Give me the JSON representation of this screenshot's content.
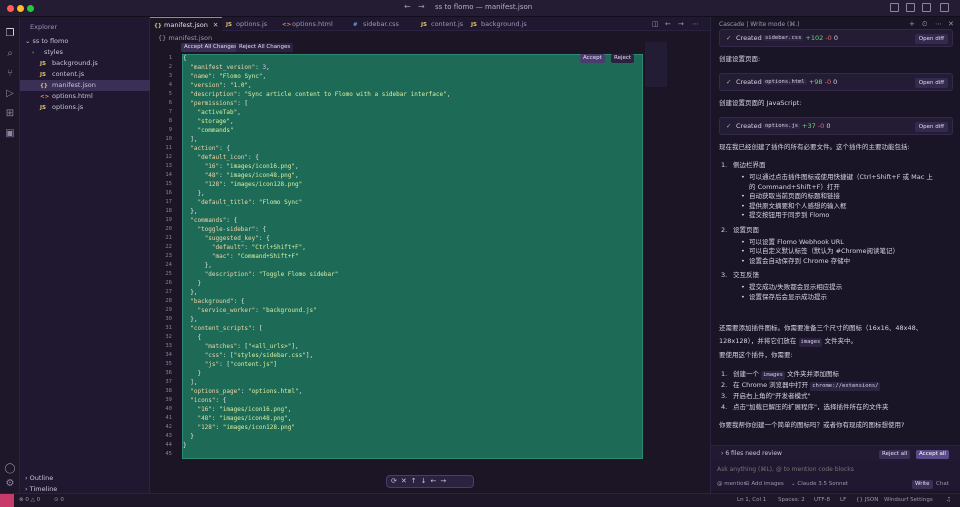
{
  "window": {
    "title": "ss to flomo — manifest.json"
  },
  "sidebar": {
    "header": "Explorer",
    "root": "ss to flomo",
    "items": [
      {
        "icon": "›",
        "label": "styles",
        "type": "folder"
      },
      {
        "icon": "JS",
        "label": "background.js",
        "type": "js"
      },
      {
        "icon": "JS",
        "label": "content.js",
        "type": "js"
      },
      {
        "icon": "{}",
        "label": "manifest.json",
        "type": "json"
      },
      {
        "icon": "<>",
        "label": "options.html",
        "type": "html"
      },
      {
        "icon": "JS",
        "label": "options.js",
        "type": "js"
      }
    ],
    "outline": "Outline",
    "timeline": "Timeline"
  },
  "tabs": [
    {
      "icon": "{}",
      "label": "manifest.json"
    },
    {
      "icon": "JS",
      "label": "options.js"
    },
    {
      "icon": "<>",
      "label": "options.html"
    },
    {
      "icon": "#",
      "label": "sidebar.css"
    },
    {
      "icon": "JS",
      "label": "content.js"
    },
    {
      "icon": "JS",
      "label": "background.js"
    }
  ],
  "editor": {
    "breadcrumb": "{} manifest.json",
    "accept_all": "Accept All Changes",
    "reject_all": "Reject All Changes",
    "accept": "Accept",
    "reject": "Reject",
    "lines": [
      "{",
      "  \"manifest_version\": 3,",
      "  \"name\": \"Flomo Sync\",",
      "  \"version\": \"1.0\",",
      "  \"description\": \"Sync article content to Flomo with a sidebar interface\",",
      "  \"permissions\": [",
      "    \"activeTab\",",
      "    \"storage\",",
      "    \"commands\"",
      "  ],",
      "  \"action\": {",
      "    \"default_icon\": {",
      "      \"16\": \"images/icon16.png\",",
      "      \"48\": \"images/icon48.png\",",
      "      \"128\": \"images/icon128.png\"",
      "    },",
      "    \"default_title\": \"Flomo Sync\"",
      "  },",
      "  \"commands\": {",
      "    \"toggle-sidebar\": {",
      "      \"suggested_key\": {",
      "        \"default\": \"Ctrl+Shift+F\",",
      "        \"mac\": \"Command+Shift+F\"",
      "      },",
      "      \"description\": \"Toggle Flomo sidebar\"",
      "    }",
      "  },",
      "  \"background\": {",
      "    \"service_worker\": \"background.js\"",
      "  },",
      "  \"content_scripts\": [",
      "    {",
      "      \"matches\": [\"<all_urls>\"],",
      "      \"css\": [\"styles/sidebar.css\"],",
      "      \"js\": [\"content.js\"]",
      "    }",
      "  ],",
      "  \"options_page\": \"options.html\",",
      "  \"icons\": {",
      "    \"16\": \"images/icon16.png\",",
      "    \"48\": \"images/icon48.png\",",
      "    \"128\": \"images/icon128.png\"",
      "  }",
      "}",
      ""
    ]
  },
  "panel": {
    "header": "Cascade | Write mode (⌘.)",
    "created": "Created",
    "open_diff": "Open diff",
    "files": [
      {
        "name": "sidebar.css",
        "plus": "+102",
        "minus": "-0",
        "zero": "0"
      },
      {
        "name": "options.html",
        "plus": "+98",
        "minus": "-0",
        "zero": "0"
      },
      {
        "name": "options.js",
        "plus": "+37",
        "minus": "-0",
        "zero": "0"
      }
    ],
    "msg_settings_page": "创建设置页面:",
    "msg_settings_js": "创建设置页面的 JavaScript:",
    "summary": "现在我已经创建了插件的所有必要文件。这个插件的主要功能包括:",
    "features": [
      {
        "num": "1.",
        "title": "侧边栏界面",
        "bullets": [
          "可以通过点击插件图标或使用快捷键（Ctrl+Shift+F 或 Mac 上",
          "的 Command+Shift+F）打开",
          "自动获取当前页面的标题和链接",
          "提供原文摘要和个人感想的输入框",
          "提交按钮用于同步到 Flomo"
        ]
      },
      {
        "num": "2.",
        "title": "设置页面",
        "bullets": [
          "可以设置 Flomo Webhook URL",
          "可以自定义默认标签（默认为 #Chrome阅读笔记）",
          "设置会自动保存到 Chrome 存储中"
        ]
      },
      {
        "num": "3.",
        "title": "交互反馈",
        "bullets": [
          "提交成功/失败都会显示相应提示",
          "设置保存后会显示成功提示"
        ]
      }
    ],
    "icons_note_1": "还需要添加插件图标。你需要准备三个尺寸的图标（16x16、48x48、",
    "icons_note_2a": "128x128），并将它们放在",
    "icons_note_chip": "images",
    "icons_note_2b": "文件夹中。",
    "usage_intro": "要使用这个插件，你需要:",
    "steps": [
      {
        "num": "1.",
        "a": "创建一个",
        "chip": "images",
        "b": "文件夹并添加图标"
      },
      {
        "num": "2.",
        "a": "在 Chrome 浏览器中打开",
        "chip": "chrome://extensions/",
        "b": ""
      },
      {
        "num": "3.",
        "a": "开启右上角的\"开发者模式\"",
        "chip": "",
        "b": ""
      },
      {
        "num": "4.",
        "a": "点击\"加载已解压的扩展程序\"，选择插件所在的文件夹",
        "chip": "",
        "b": ""
      }
    ],
    "closing": "你要我帮你创建一个简单的图标吗？或者你有现成的图标想使用?",
    "review": "6 files need review",
    "reject_all": "Reject all",
    "accept_all": "Accept all",
    "input_placeholder": "Ask anything (⌘L), @ to mention code blocks",
    "mention": "mention",
    "add_images": "Add images",
    "model": "Claude 3.5 Sonnet",
    "write": "Write",
    "chat": "Chat"
  },
  "status": {
    "errors": "0",
    "warnings": "0",
    "ports": "0",
    "position": "Ln 1, Col 1",
    "spaces": "Spaces: 2",
    "encoding": "UTF-8",
    "eol": "LF",
    "lang": "JSON",
    "windsurf": "Windsurf Settings"
  },
  "colors": {
    "accent": "#a070ff",
    "diff_bg": "#1d6a57"
  }
}
